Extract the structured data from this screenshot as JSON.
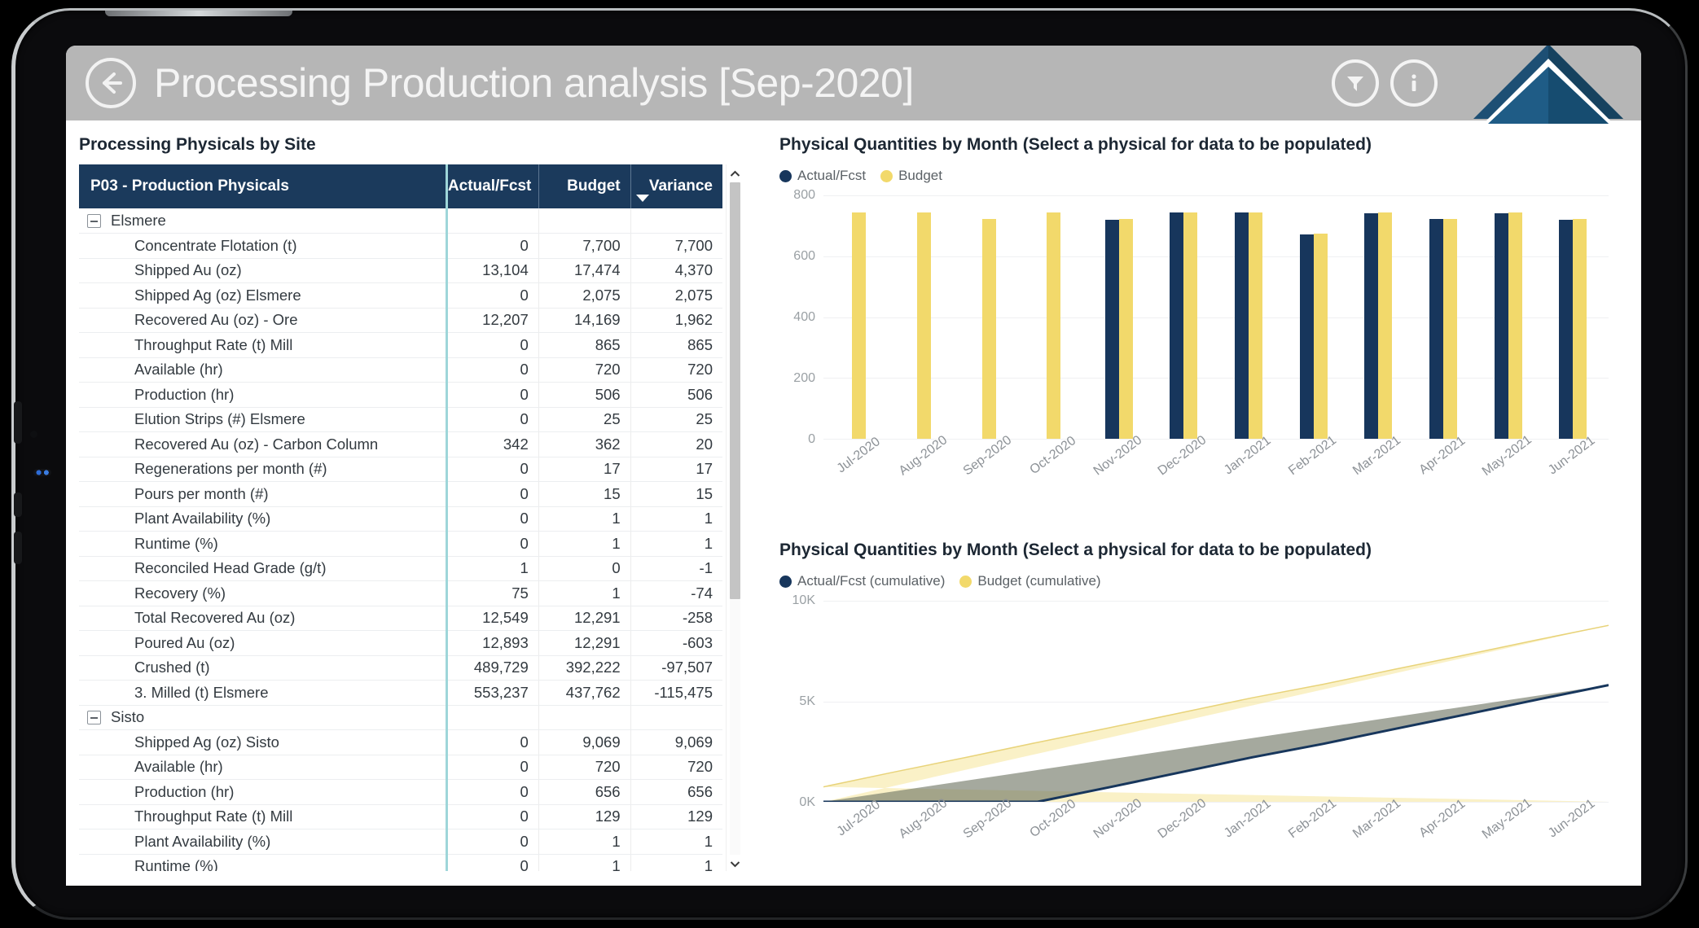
{
  "header": {
    "title": "Processing Production analysis [Sep-2020]",
    "back_icon": "arrow-left-circle-icon",
    "filter_icon": "funnel-icon",
    "info_icon": "info-circle-icon",
    "logo": "pyramid-logo",
    "bar_color": "#b6b6b6"
  },
  "left_panel": {
    "section_title": "Processing Physicals by Site",
    "columns": [
      "P03 - Production Physicals",
      "Actual/Fcst",
      "Budget",
      "Variance"
    ],
    "sort_indicator": "descending",
    "rows": [
      {
        "type": "group",
        "label": "Elsmere",
        "actual": "",
        "budget": "",
        "variance": "",
        "sign": "none"
      },
      {
        "type": "item",
        "label": "Concentrate Flotation (t)",
        "actual": "0",
        "budget": "7,700",
        "variance": "7,700",
        "sign": "pos"
      },
      {
        "type": "item",
        "label": "Shipped Au (oz)",
        "actual": "13,104",
        "budget": "17,474",
        "variance": "4,370",
        "sign": "pos"
      },
      {
        "type": "item",
        "label": "Shipped Ag (oz) Elsmere",
        "actual": "0",
        "budget": "2,075",
        "variance": "2,075",
        "sign": "pos"
      },
      {
        "type": "item",
        "label": "Recovered Au (oz) - Ore",
        "actual": "12,207",
        "budget": "14,169",
        "variance": "1,962",
        "sign": "pos"
      },
      {
        "type": "item",
        "label": "Throughput Rate (t) Mill",
        "actual": "0",
        "budget": "865",
        "variance": "865",
        "sign": "pos"
      },
      {
        "type": "item",
        "label": "Available (hr)",
        "actual": "0",
        "budget": "720",
        "variance": "720",
        "sign": "pos"
      },
      {
        "type": "item",
        "label": "Production (hr)",
        "actual": "0",
        "budget": "506",
        "variance": "506",
        "sign": "pos"
      },
      {
        "type": "item",
        "label": "Elution Strips (#) Elsmere",
        "actual": "0",
        "budget": "25",
        "variance": "25",
        "sign": "pos"
      },
      {
        "type": "item",
        "label": "Recovered Au (oz) - Carbon Column",
        "actual": "342",
        "budget": "362",
        "variance": "20",
        "sign": "pos"
      },
      {
        "type": "item",
        "label": "Regenerations per month (#)",
        "actual": "0",
        "budget": "17",
        "variance": "17",
        "sign": "pos"
      },
      {
        "type": "item",
        "label": "Pours per month (#)",
        "actual": "0",
        "budget": "15",
        "variance": "15",
        "sign": "pos"
      },
      {
        "type": "item",
        "label": "Plant Availability (%)",
        "actual": "0",
        "budget": "1",
        "variance": "1",
        "sign": "pos"
      },
      {
        "type": "item",
        "label": "Runtime (%)",
        "actual": "0",
        "budget": "1",
        "variance": "1",
        "sign": "pos"
      },
      {
        "type": "item",
        "label": "Reconciled Head Grade (g/t)",
        "actual": "1",
        "budget": "0",
        "variance": "-1",
        "sign": "pos"
      },
      {
        "type": "item",
        "label": "Recovery (%)",
        "actual": "75",
        "budget": "1",
        "variance": "-74",
        "sign": "pos"
      },
      {
        "type": "item",
        "label": "Total Recovered Au (oz)",
        "actual": "12,549",
        "budget": "12,291",
        "variance": "-258",
        "sign": "pos"
      },
      {
        "type": "item",
        "label": "Poured Au (oz)",
        "actual": "12,893",
        "budget": "12,291",
        "variance": "-603",
        "sign": "pos"
      },
      {
        "type": "item",
        "label": "Crushed (t)",
        "actual": "489,729",
        "budget": "392,222",
        "variance": "-97,507",
        "sign": "neg"
      },
      {
        "type": "item",
        "label": "3. Milled (t) Elsmere",
        "actual": "553,237",
        "budget": "437,762",
        "variance": "-115,475",
        "sign": "neg"
      },
      {
        "type": "group",
        "label": "Sisto",
        "actual": "",
        "budget": "",
        "variance": "",
        "sign": "none"
      },
      {
        "type": "item",
        "label": "Shipped Ag (oz) Sisto",
        "actual": "0",
        "budget": "9,069",
        "variance": "9,069",
        "sign": "pos"
      },
      {
        "type": "item",
        "label": "Available (hr)",
        "actual": "0",
        "budget": "720",
        "variance": "720",
        "sign": "pos"
      },
      {
        "type": "item",
        "label": "Production (hr)",
        "actual": "0",
        "budget": "656",
        "variance": "656",
        "sign": "pos"
      },
      {
        "type": "item",
        "label": "Throughput Rate (t) Mill",
        "actual": "0",
        "budget": "129",
        "variance": "129",
        "sign": "pos"
      },
      {
        "type": "item",
        "label": "Plant Availability (%)",
        "actual": "0",
        "budget": "1",
        "variance": "1",
        "sign": "pos"
      },
      {
        "type": "item",
        "label": "Runtime (%)",
        "actual": "0",
        "budget": "1",
        "variance": "1",
        "sign": "pos"
      }
    ],
    "scrollbar": {
      "up_icon": "chevron-up-icon",
      "down_icon": "chevron-down-icon"
    }
  },
  "colors": {
    "actual": "#17365c",
    "budget": "#f2d96b",
    "header_navy": "#1b3a5c",
    "variance_positive": "#4a7a4f",
    "variance_negative": "#c0504d",
    "divider_teal": "#9ed6d9"
  },
  "chart_data": [
    {
      "type": "bar",
      "title": "Physical Quantities by Month (Select a physical for data to be populated)",
      "xlabel": "",
      "ylabel": "",
      "ylim": [
        0,
        800
      ],
      "yticks": [
        "0",
        "200",
        "400",
        "600",
        "800"
      ],
      "grid": true,
      "legend_position": "top-left",
      "categories": [
        "Jul-2020",
        "Aug-2020",
        "Sep-2020",
        "Oct-2020",
        "Nov-2020",
        "Dec-2020",
        "Jan-2021",
        "Feb-2021",
        "Mar-2021",
        "Apr-2021",
        "May-2021",
        "Jun-2021"
      ],
      "series": [
        {
          "name": "Actual/Fcst",
          "color": "#17365c",
          "values": [
            null,
            null,
            null,
            null,
            720,
            745,
            745,
            672,
            740,
            722,
            740,
            720
          ]
        },
        {
          "name": "Budget",
          "color": "#f2d96b",
          "values": [
            745,
            745,
            722,
            745,
            722,
            745,
            745,
            675,
            745,
            722,
            745,
            722
          ]
        }
      ]
    },
    {
      "type": "area",
      "title": "Physical Quantities by Month (Select a physical for data to be populated)",
      "xlabel": "",
      "ylabel": "",
      "ylim": [
        0,
        10000
      ],
      "yticks": [
        "0K",
        "5K",
        "10K"
      ],
      "grid": true,
      "legend_position": "top-left",
      "categories": [
        "Jul-2020",
        "Aug-2020",
        "Sep-2020",
        "Oct-2020",
        "Nov-2020",
        "Dec-2020",
        "Jan-2021",
        "Feb-2021",
        "Mar-2021",
        "Apr-2021",
        "May-2021",
        "Jun-2021"
      ],
      "series": [
        {
          "name": "Actual/Fcst (cumulative)",
          "color": "#17365c",
          "values": [
            0,
            0,
            0,
            0,
            720,
            1465,
            2210,
            2882,
            3622,
            4344,
            5084,
            5804
          ]
        },
        {
          "name": "Budget (cumulative)",
          "color": "#f2d96b",
          "values": [
            745,
            1490,
            2212,
            2957,
            3679,
            4424,
            5169,
            5844,
            6589,
            7311,
            8056,
            8778
          ]
        }
      ]
    }
  ]
}
